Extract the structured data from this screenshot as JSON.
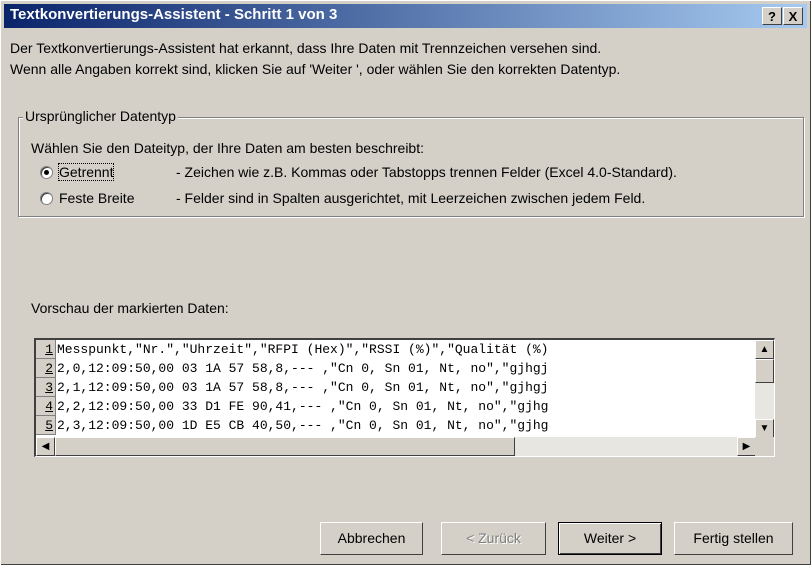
{
  "window": {
    "title": "Textkonvertierungs-Assistent - Schritt 1 von 3",
    "help_button": "?",
    "close_button": "X"
  },
  "intro": {
    "line1": "Der Textkonvertierungs-Assistent hat erkannt, dass Ihre Daten mit Trennzeichen versehen sind.",
    "line2": "Wenn alle Angaben korrekt sind, klicken Sie auf 'Weiter ', oder wählen Sie den korrekten Datentyp."
  },
  "datatype": {
    "group_label": "Ursprünglicher Datentyp",
    "prompt": "Wählen Sie den Dateityp, der Ihre Daten am besten beschreibt:",
    "options": [
      {
        "label": "Getrennt",
        "description": "- Zeichen wie z.B. Kommas oder Tabstopps trennen Felder (Excel 4.0-Standard).",
        "selected": true
      },
      {
        "label": "Feste Breite",
        "description": "- Felder sind in Spalten ausgerichtet, mit Leerzeichen zwischen jedem Feld.",
        "selected": false
      }
    ]
  },
  "preview": {
    "label": "Vorschau der markierten Daten:",
    "rows": [
      {
        "num": "1",
        "text": "Messpunkt,\"Nr.\",\"Uhrzeit\",\"RFPI (Hex)\",\"RSSI (%)\",\"Qualität (%)"
      },
      {
        "num": "2",
        "text": "2,0,12:09:50,00 03 1A 57 58,8,---   ,\"Cn 0, Sn 01, Nt, no\",\"gjhgj"
      },
      {
        "num": "3",
        "text": "2,1,12:09:50,00 03 1A 57 58,8,---   ,\"Cn 0, Sn 01, Nt, no\",\"gjhgj"
      },
      {
        "num": "4",
        "text": "2,2,12:09:50,00 33 D1 FE 90,41,---   ,\"Cn 0, Sn 01, Nt, no\",\"gjhg"
      },
      {
        "num": "5",
        "text": "2,3,12:09:50,00 1D E5 CB 40,50,---   ,\"Cn 0, Sn 01, Nt, no\",\"gjhg"
      }
    ]
  },
  "buttons": {
    "cancel": "Abbrechen",
    "back": "< Zurück",
    "next": "Weiter >",
    "finish": "Fertig stellen"
  }
}
